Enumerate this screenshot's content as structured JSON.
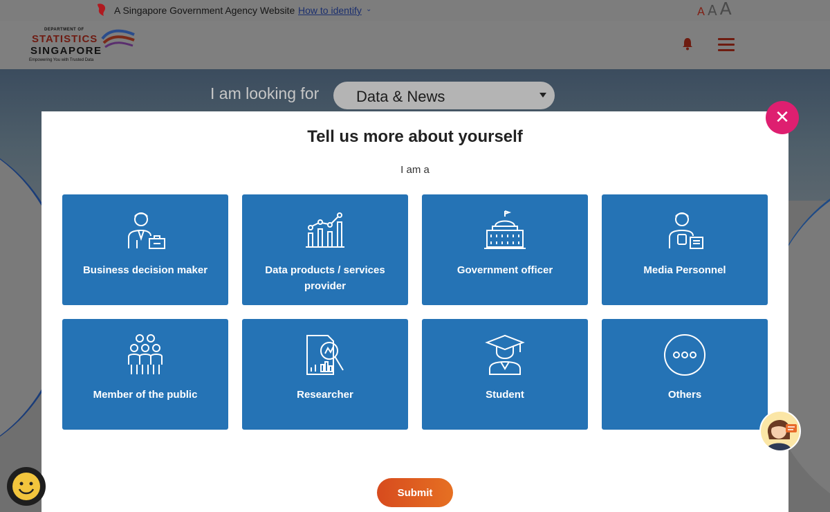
{
  "masthead": {
    "gov_text": "A Singapore Government Agency Website",
    "identify_label": "How to identify",
    "font_small": "A",
    "font_medium": "A",
    "font_large": "A"
  },
  "header": {
    "logo_dept": "DEPARTMENT OF",
    "logo_statistics": "STATISTICS",
    "logo_singapore": "SINGAPORE",
    "logo_tagline": "Empowering You with Trusted Data"
  },
  "hero": {
    "looking_for": "I am looking for",
    "selected": "Data & News"
  },
  "modal": {
    "title": "Tell us more about yourself",
    "subtitle": "I am a",
    "options": [
      {
        "label": "Business decision maker",
        "icon": "business-person-icon"
      },
      {
        "label": "Data products / services provider",
        "icon": "chart-icon"
      },
      {
        "label": "Government officer",
        "icon": "government-building-icon"
      },
      {
        "label": "Media Personnel",
        "icon": "media-person-icon"
      },
      {
        "label": "Member of the public",
        "icon": "people-group-icon"
      },
      {
        "label": "Researcher",
        "icon": "research-magnifier-icon"
      },
      {
        "label": "Student",
        "icon": "graduate-icon"
      },
      {
        "label": "Others",
        "icon": "more-dots-icon"
      }
    ],
    "submit_label": "Submit",
    "close_label": "✕"
  },
  "colors": {
    "card_blue": "#2573b5",
    "close_pink": "#de1f70",
    "submit_orange": "#e0591f"
  }
}
